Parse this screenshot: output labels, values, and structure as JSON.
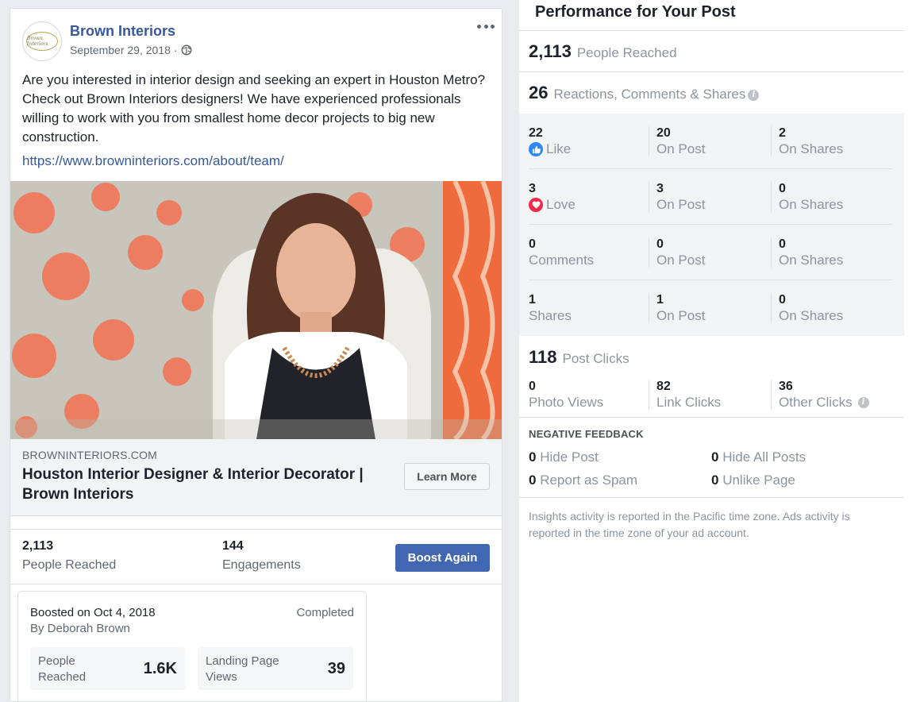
{
  "post": {
    "page_name": "Brown Interiors",
    "avatar_text": "Brown Interiors",
    "date": "September 29, 2018",
    "date_separator": "·",
    "text": "Are you interested in interior design and seeking an expert in Houston Metro? Check out Brown Interiors designers! We have experienced professionals willing to work with you from smallest home decor projects to big new construction.",
    "link": "https://www.browninteriors.com/about/team/",
    "link_card": {
      "domain": "BROWNINTERIORS.COM",
      "title": "Houston Interior Designer & Interior Decorator | Brown Interiors",
      "button": "Learn More"
    },
    "stats": {
      "reached_value": "2,113",
      "reached_label": "People Reached",
      "engagements_value": "144",
      "engagements_label": "Engagements",
      "boost_button": "Boost Again"
    },
    "boost": {
      "date": "Boosted on Oct 4, 2018",
      "by": "By Deborah Brown",
      "status": "Completed",
      "people_reached_label": "People Reached",
      "people_reached_value": "1.6K",
      "landing_label": "Landing Page Views",
      "landing_value": "39"
    }
  },
  "performance": {
    "title": "Performance for Your Post",
    "reached": {
      "value": "2,113",
      "label": "People Reached"
    },
    "engagement": {
      "value": "26",
      "label": "Reactions, Comments & Shares"
    },
    "rows": [
      {
        "icon": "like-icon",
        "cells": [
          {
            "num": "22",
            "label": "Like"
          },
          {
            "num": "20",
            "label": "On Post"
          },
          {
            "num": "2",
            "label": "On Shares"
          }
        ]
      },
      {
        "icon": "love-icon",
        "cells": [
          {
            "num": "3",
            "label": "Love"
          },
          {
            "num": "3",
            "label": "On Post"
          },
          {
            "num": "0",
            "label": "On Shares"
          }
        ]
      },
      {
        "icon": null,
        "cells": [
          {
            "num": "0",
            "label": "Comments"
          },
          {
            "num": "0",
            "label": "On Post"
          },
          {
            "num": "0",
            "label": "On Shares"
          }
        ]
      },
      {
        "icon": null,
        "cells": [
          {
            "num": "1",
            "label": "Shares"
          },
          {
            "num": "1",
            "label": "On Post"
          },
          {
            "num": "0",
            "label": "On Shares"
          }
        ]
      }
    ],
    "clicks": {
      "value": "118",
      "label": "Post Clicks",
      "cells": [
        {
          "num": "0",
          "label": "Photo Views"
        },
        {
          "num": "82",
          "label": "Link Clicks"
        },
        {
          "num": "36",
          "label": "Other Clicks"
        }
      ]
    },
    "negative": {
      "title": "NEGATIVE FEEDBACK",
      "items": [
        {
          "num": "0",
          "label": "Hide Post"
        },
        {
          "num": "0",
          "label": "Hide All Posts"
        },
        {
          "num": "0",
          "label": "Report as Spam"
        },
        {
          "num": "0",
          "label": "Unlike Page"
        }
      ]
    },
    "footnote": "Insights activity is reported in the Pacific time zone. Ads activity is reported in the time zone of your ad account."
  },
  "colors": {
    "link_blue": "#365899",
    "brand_blue": "#4267b2",
    "like_blue": "#2d88ff",
    "love_red": "#f0284a",
    "muted_text": "#8d949e"
  }
}
